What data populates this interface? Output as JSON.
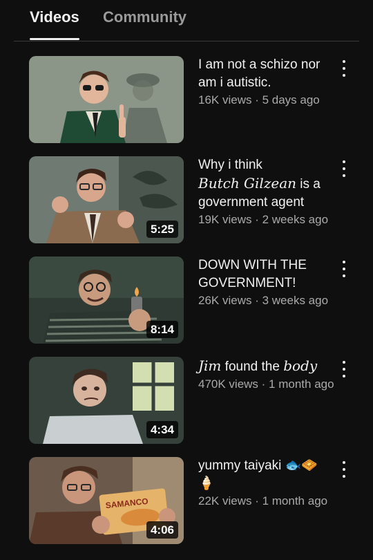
{
  "tabs": {
    "videos": "Videos",
    "community": "Community"
  },
  "videos": [
    {
      "title_line1": "I am not a schizo nor",
      "title_line2": "am i autistic.",
      "stats": "16K views · 5 days ago",
      "duration": ""
    },
    {
      "title_line1": "Why i think",
      "title_hand": "Butch Gilzean",
      "title_rest": "is a",
      "title_line3": "government agent",
      "stats": "19K views · 2 weeks ago",
      "duration": "5:25"
    },
    {
      "title_line1": "DOWN WITH THE",
      "title_line2": "GOVERNMENT!",
      "stats": "26K views · 3 weeks ago",
      "duration": "8:14"
    },
    {
      "title_hand1": "Jim",
      "title_mid": "found the",
      "title_hand2": "body",
      "stats": "470K views · 1 month ago",
      "duration": "4:34"
    },
    {
      "title_line1": "yummy taiyaki",
      "title_emoji1": "🐟",
      "title_emoji2": "🧇",
      "title_emoji3": "🍦",
      "stats": "22K views · 1 month ago",
      "duration": "4:06",
      "package_text": "SAMANCO"
    }
  ],
  "colors": {
    "background": "#0f0f0f",
    "text": "#f1f1f1",
    "secondary": "#aaaaaa",
    "inactive_tab": "#9a9a9a"
  },
  "icons": {
    "more": "more-vert-icon"
  }
}
